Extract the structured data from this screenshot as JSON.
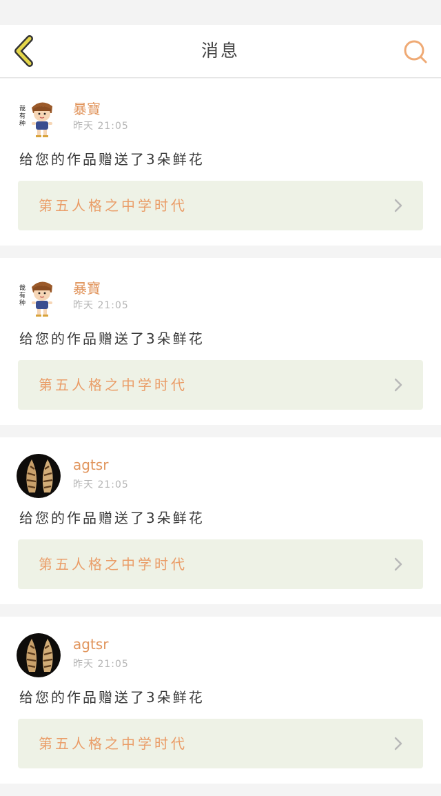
{
  "header": {
    "title": "消息"
  },
  "colors": {
    "accent": "#e1955d",
    "back_icon": "#e4d64a",
    "search_icon": "#efaa75",
    "link_bg": "#eef2e6"
  },
  "notifications": [
    {
      "avatar": "cartoon-boy-avatar",
      "username": "暴寶",
      "time": "昨天 21:05",
      "message": "给您的作品赠送了3朵鲜花",
      "work_title": "第五人格之中学时代"
    },
    {
      "avatar": "cartoon-boy-avatar",
      "username": "暴寶",
      "time": "昨天 21:05",
      "message": "给您的作品赠送了3朵鲜花",
      "work_title": "第五人格之中学时代"
    },
    {
      "avatar": "shell-photo-avatar",
      "username": "agtsr",
      "time": "昨天 21:05",
      "message": "给您的作品赠送了3朵鲜花",
      "work_title": "第五人格之中学时代"
    },
    {
      "avatar": "shell-photo-avatar",
      "username": "agtsr",
      "time": "昨天 21:05",
      "message": "给您的作品赠送了3朵鲜花",
      "work_title": "第五人格之中学时代"
    }
  ]
}
